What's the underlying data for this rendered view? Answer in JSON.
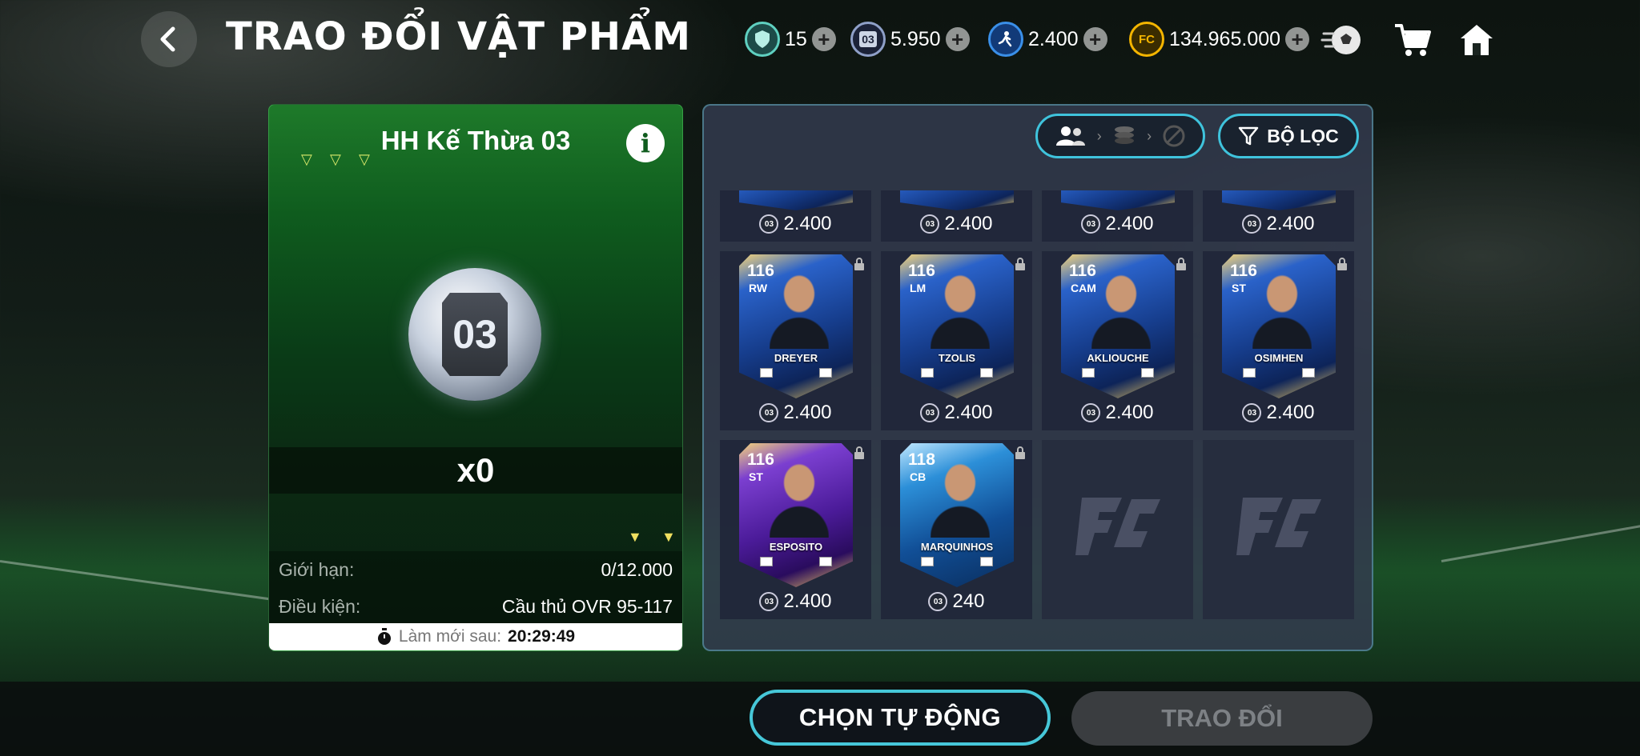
{
  "header": {
    "title": "TRAO ĐỔI VẬT PHẨM",
    "currencies": [
      {
        "name": "shield",
        "value": "15",
        "color": "#5fd0c0"
      },
      {
        "name": "03-token",
        "value": "5.950",
        "color": "#8fa0c8"
      },
      {
        "name": "trade-token",
        "value": "2.400",
        "color": "#3a8fe8"
      },
      {
        "name": "fc-coin",
        "value": "134.965.000",
        "color": "#f4b500"
      }
    ]
  },
  "offer": {
    "title": "HH Kế Thừa 03",
    "coin_label": "03",
    "quantity": "x0",
    "limit_label": "Giới hạn:",
    "limit_value": "0/12.000",
    "condition_label": "Điều kiện:",
    "condition_value": "Cầu thủ OVR 95-117",
    "refresh_label": "Làm mới sau:",
    "refresh_time": "20:29:49"
  },
  "filter": {
    "label": "BỘ LỌC"
  },
  "top_row_prices": [
    "2.400",
    "2.400",
    "2.400",
    "2.400"
  ],
  "cards": [
    {
      "ovr": "116",
      "pos": "RW",
      "name": "DREYER",
      "price": "2.400",
      "style": "gold"
    },
    {
      "ovr": "116",
      "pos": "LM",
      "name": "TZOLIS",
      "price": "2.400",
      "style": "gold"
    },
    {
      "ovr": "116",
      "pos": "CAM",
      "name": "AKLIOUCHE",
      "price": "2.400",
      "style": "gold"
    },
    {
      "ovr": "116",
      "pos": "ST",
      "name": "OSIMHEN",
      "price": "2.400",
      "style": "gold"
    },
    {
      "ovr": "116",
      "pos": "ST",
      "name": "ESPOSITO",
      "price": "2.400",
      "style": "purple"
    },
    {
      "ovr": "118",
      "pos": "CB",
      "name": "MARQUINHOS",
      "price": "240",
      "style": "blue2"
    }
  ],
  "price_token_label": "03",
  "buttons": {
    "auto": "CHỌN TỰ ĐỘNG",
    "trade": "TRAO ĐỔI"
  }
}
